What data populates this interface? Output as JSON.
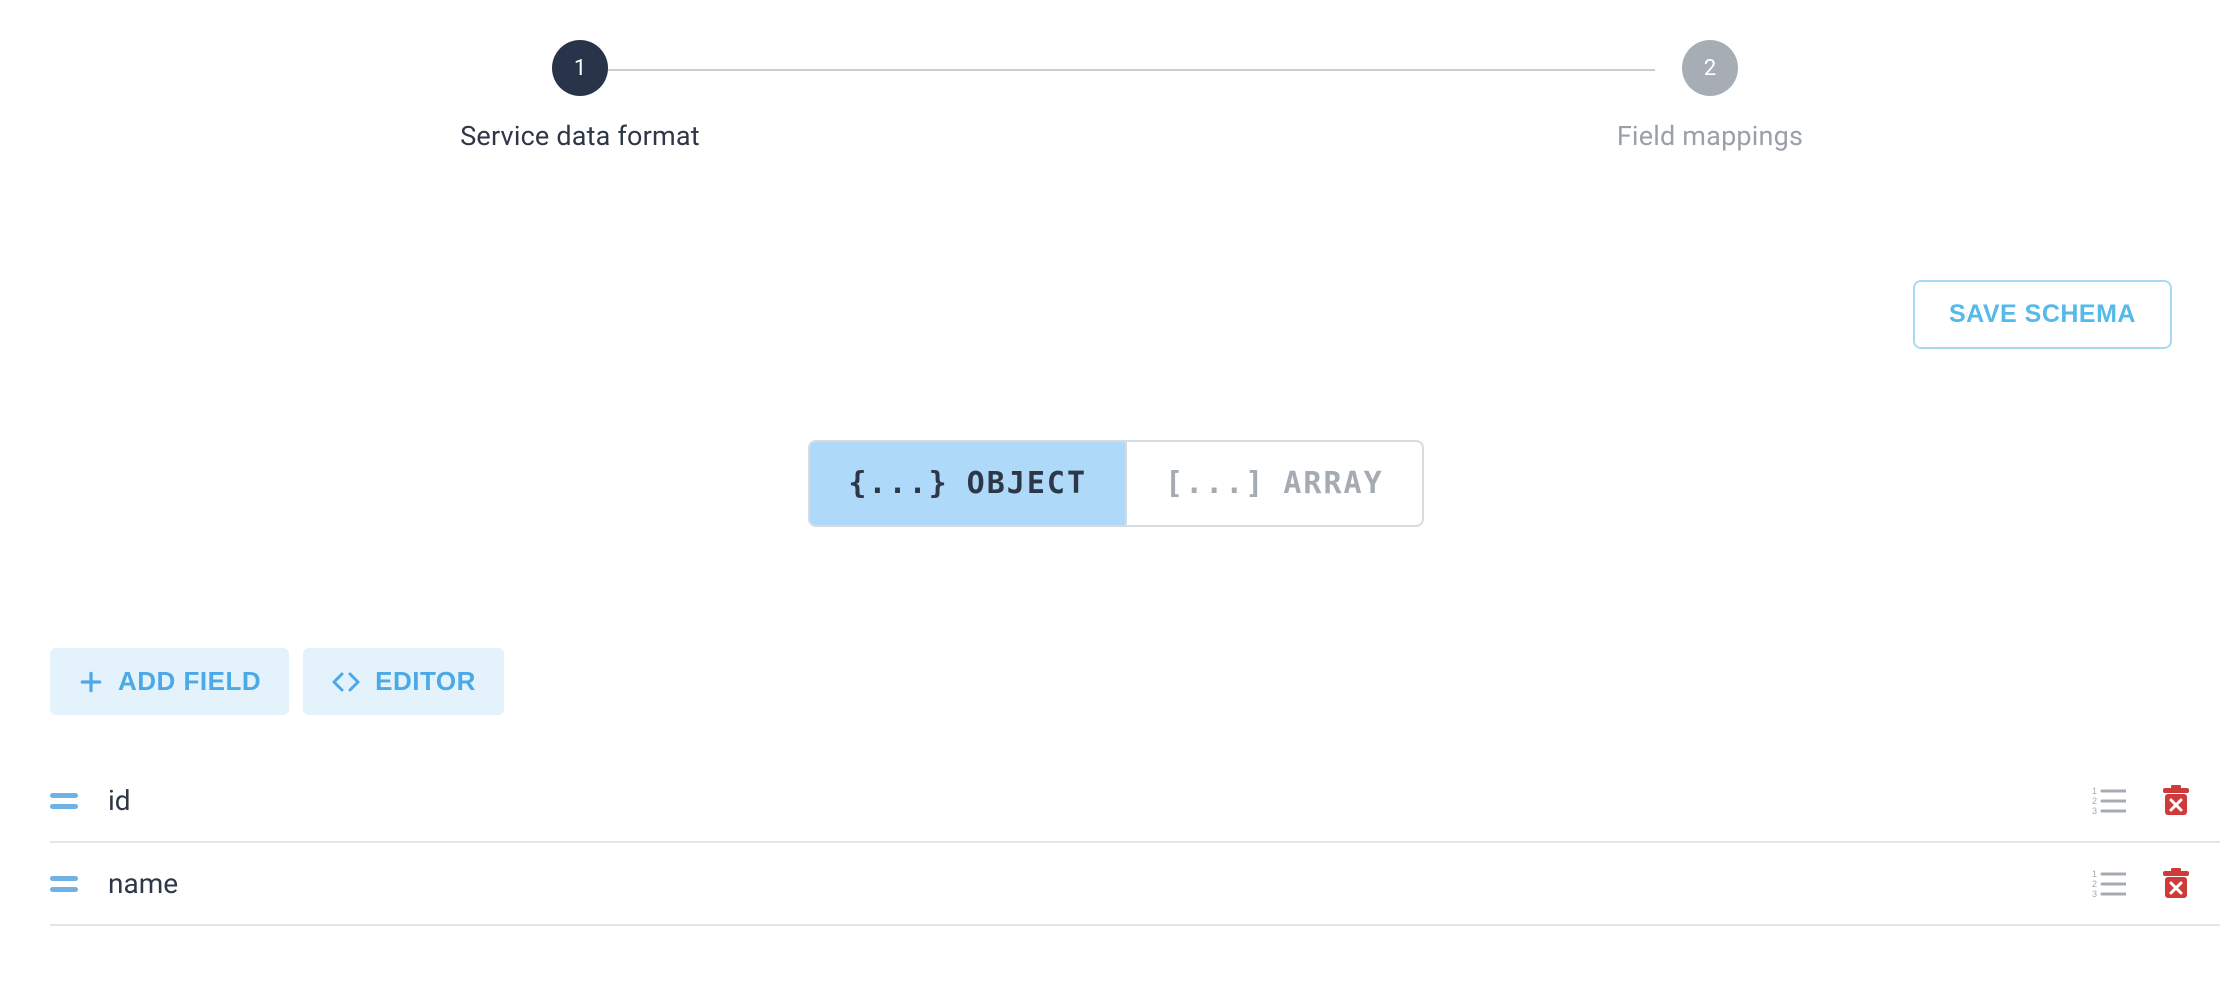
{
  "stepper": {
    "steps": [
      {
        "num": "1",
        "label": "Service data format",
        "active": true
      },
      {
        "num": "2",
        "label": "Field mappings",
        "active": false
      }
    ]
  },
  "actions": {
    "save_label": "SAVE SCHEMA",
    "add_field_label": "ADD FIELD",
    "editor_label": "EDITOR"
  },
  "type_toggle": {
    "options": [
      {
        "glyph": "{...}",
        "label": "OBJECT",
        "selected": true
      },
      {
        "glyph": "[...]",
        "label": "ARRAY",
        "selected": false
      }
    ]
  },
  "fields": [
    {
      "name": "id"
    },
    {
      "name": "name"
    }
  ]
}
